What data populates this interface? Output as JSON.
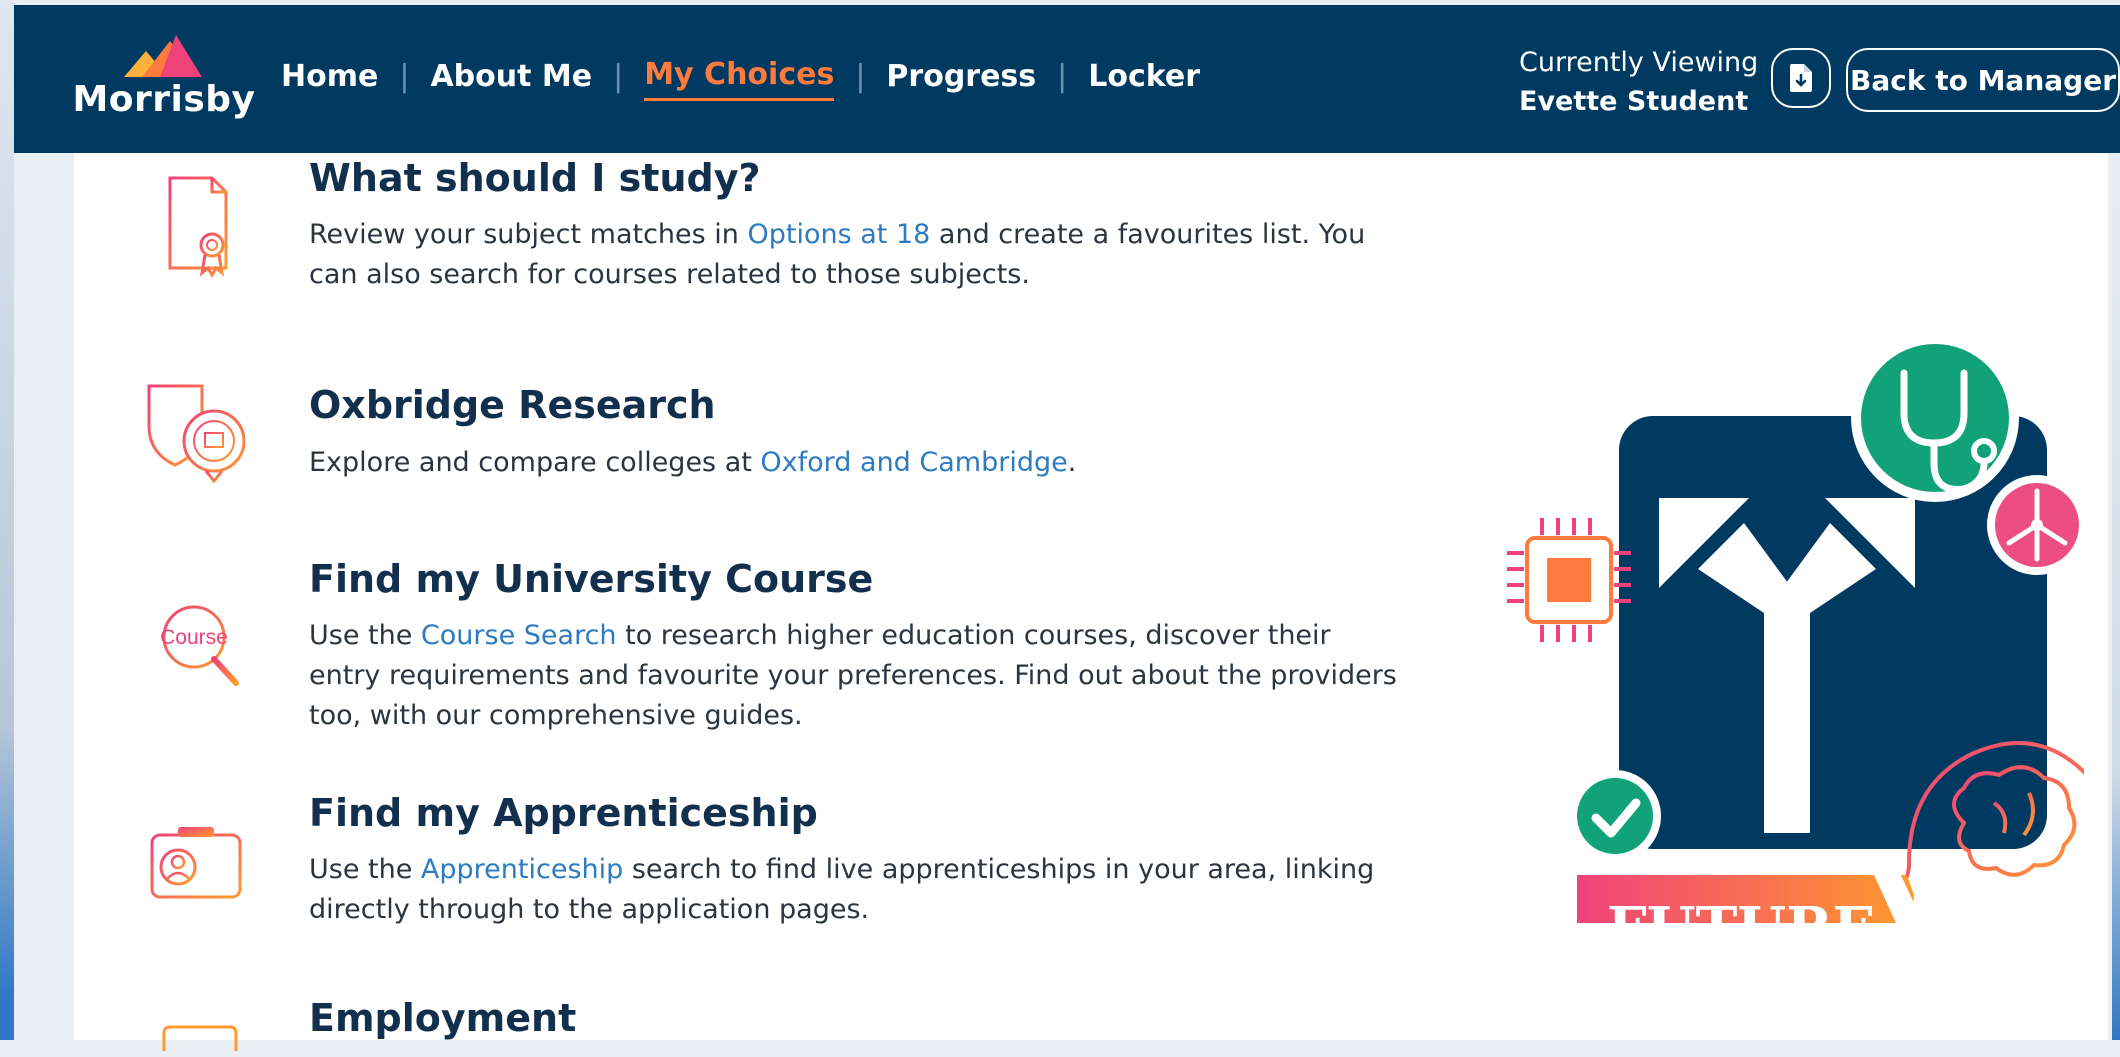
{
  "app": {
    "logo_text": "Morrisby"
  },
  "nav": {
    "items": [
      {
        "label": "Home",
        "active": false
      },
      {
        "label": "About Me",
        "active": false
      },
      {
        "label": "My Choices",
        "active": true
      },
      {
        "label": "Progress",
        "active": false
      },
      {
        "label": "Locker",
        "active": false
      }
    ]
  },
  "viewing": {
    "label": "Currently Viewing",
    "student": "Evette Student"
  },
  "header_buttons": {
    "document_icon": "document-icon",
    "back_label": "Back to Manager"
  },
  "items": [
    {
      "title": "What should I study?",
      "icon": "certificate-icon",
      "before": "Review your subject matches in ",
      "link": "Options at 18",
      "after": " and create a favourites list. You can also search for courses related to those subjects."
    },
    {
      "title": "Oxbridge Research",
      "icon": "university-crest-icon",
      "before": "Explore and compare colleges at ",
      "link": "Oxford and Cambridge",
      "after": "."
    },
    {
      "title": "Find my University Course",
      "icon": "course-search-icon",
      "icon_text": "Course",
      "before": "Use the ",
      "link": "Course Search",
      "after": " to research higher education courses, discover their entry requirements and favourite your preferences. Find out about the providers too, with our comprehensive guides."
    },
    {
      "title": "Find my Apprenticeship",
      "icon": "id-badge-icon",
      "before": "Use the ",
      "link": "Apprenticeship",
      "after": " search to find live apprenticeships in your area, linking directly through to the application pages."
    },
    {
      "title": "Employment",
      "icon": "briefcase-icon"
    }
  ],
  "illustration": {
    "banner_text": "FUTURE"
  },
  "colors": {
    "navbar": "#003a61",
    "accent_orange": "#ff7a3d",
    "link_blue": "#2d7bc0",
    "title_navy": "#12304e",
    "gradient_start": "#f0427a",
    "gradient_end": "#ff9a2e"
  }
}
